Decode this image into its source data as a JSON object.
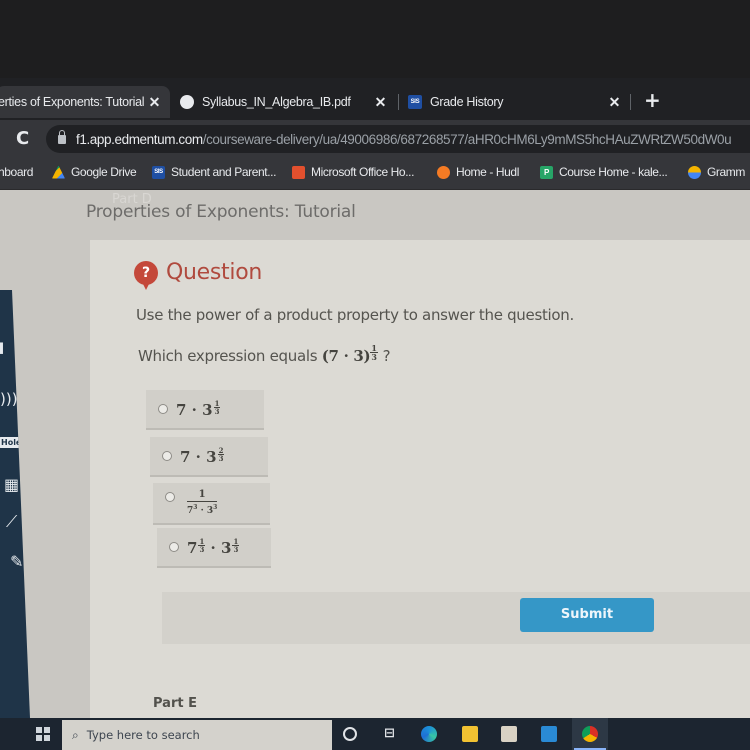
{
  "browser": {
    "tabs": [
      {
        "label": "erties of Exponents: Tutorial",
        "active": true,
        "close": "✕"
      },
      {
        "label": "Syllabus_IN_Algebra_IB.pdf",
        "active": false,
        "close": "✕"
      },
      {
        "label": "Grade History",
        "active": false,
        "close": "✕",
        "icon_text": "SIS"
      }
    ],
    "new_tab": "+",
    "reload_icon": "C",
    "url_host": "f1.app.edmentum.com",
    "url_path": "/courseware-delivery/ua/49006986/687268577/aHR0cHM6Ly9mMS5hcHAuZWRtZW50dW0u",
    "bookmarks": [
      {
        "label": "hboard"
      },
      {
        "label": "Google Drive"
      },
      {
        "label": "Student and Parent...",
        "icon_text": "SIS"
      },
      {
        "label": "Microsoft Office Ho..."
      },
      {
        "label": "Home - Hudl"
      },
      {
        "label": "Course Home - kale...",
        "icon_text": "P"
      },
      {
        "label": "Gramm"
      }
    ]
  },
  "page": {
    "ghost_text": "Part D",
    "title": "Properties of Exponents: Tutorial",
    "question_badge": "?",
    "question_header": "Question",
    "prompt": "Use the power of a product property to answer the question.",
    "question_text": "Which expression equals ",
    "question_expr_base": "(7 · 3)",
    "question_expr_exp_num": "1",
    "question_expr_exp_den": "3",
    "question_mark": "?",
    "options": [
      {
        "base_left": "7",
        "dot": "·",
        "base_right": "3",
        "exp_num": "1",
        "exp_den": "3"
      },
      {
        "base_left": "7",
        "dot": "·",
        "base_right": "3",
        "exp_num": "2",
        "exp_den": "3"
      },
      {
        "numerator": "1",
        "denominator_left": "7",
        "denominator_left_exp": "3",
        "dot": "·",
        "denominator_right": "3",
        "denominator_right_exp": "3"
      },
      {
        "base_left": "7",
        "left_exp_num": "1",
        "left_exp_den": "3",
        "dot": "·",
        "base_right": "3",
        "exp_num": "1",
        "exp_den": "3"
      }
    ],
    "submit_label": "Submit",
    "next_part": "Part E"
  },
  "sidebar": {
    "icons": [
      "book-icon",
      "audio-icon",
      "hole-badge",
      "calculator-icon",
      "graph-icon",
      "highlighter-icon"
    ],
    "hole_label": "Hole"
  },
  "taskbar": {
    "search_placeholder": "Type here to search",
    "search_icon": "⌕",
    "taskview_glyph": "⊟"
  },
  "colors": {
    "accent_submit": "#3597c7",
    "question_red": "#c4483a",
    "sidebar_navy": "#1f3448"
  }
}
